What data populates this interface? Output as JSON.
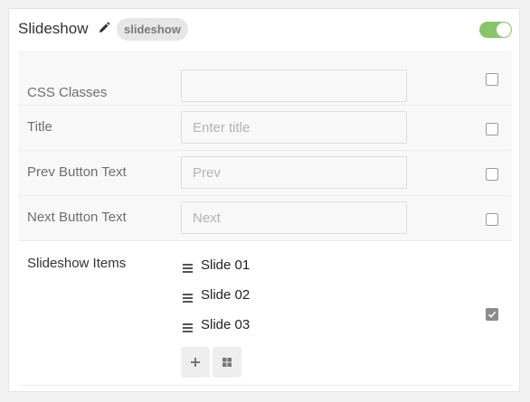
{
  "header": {
    "title": "Slideshow",
    "type_badge": "slideshow",
    "enabled": true,
    "edit_icon": "pencil-icon"
  },
  "fields": [
    {
      "label": "CSS Classes",
      "value": "",
      "placeholder": "",
      "checked": false
    },
    {
      "label": "Title",
      "value": "",
      "placeholder": "Enter title",
      "checked": false
    },
    {
      "label": "Prev Button Text",
      "value": "",
      "placeholder": "Prev",
      "checked": false
    },
    {
      "label": "Next Button Text",
      "value": "",
      "placeholder": "Next",
      "checked": false
    }
  ],
  "slideshow_items": {
    "label": "Slideshow Items",
    "items": [
      "Slide 01",
      "Slide 02",
      "Slide 03"
    ],
    "checked": true,
    "add_icon": "plus-icon",
    "grid_icon": "grid-icon"
  },
  "colors": {
    "toggle_on": "#8ac46a",
    "badge_bg": "#e6e6e6",
    "row_bg": "#f8f8f8"
  }
}
